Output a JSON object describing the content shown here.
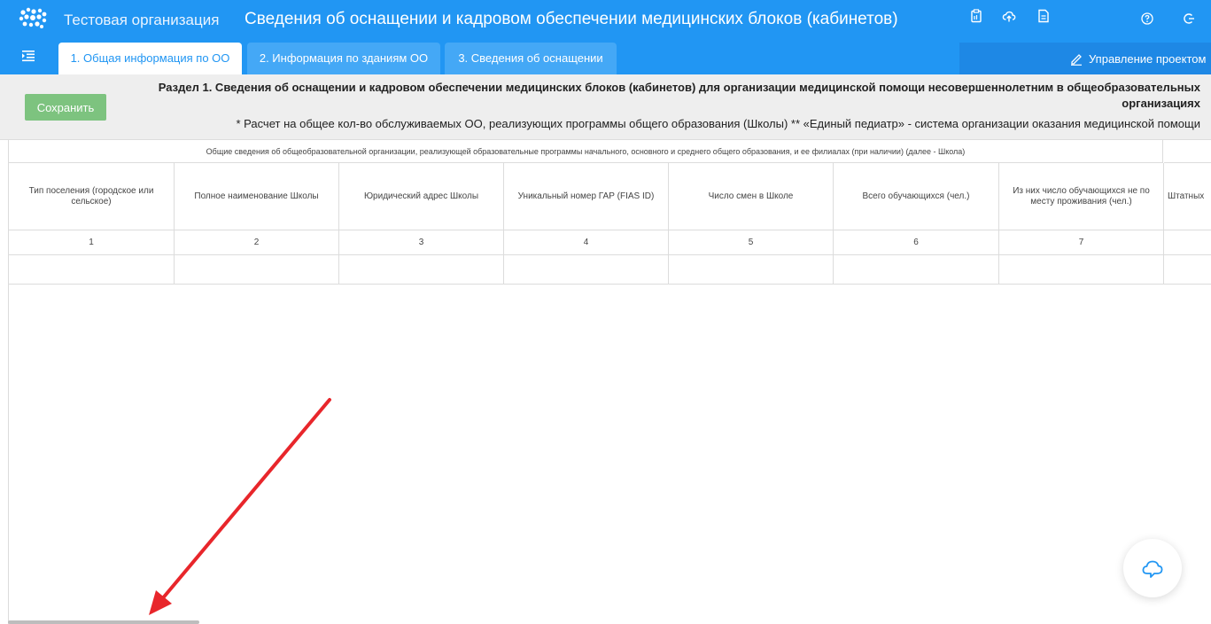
{
  "header": {
    "organization": "Тестовая организация",
    "app_title": "Сведения об оснащении и кадровом обеспечении медицинских блоков (кабинетов)",
    "brand_color": "#2196f3"
  },
  "tabs": [
    {
      "label": "1. Общая информация по ОО",
      "active": true
    },
    {
      "label": "2. Информация по зданиям ОО",
      "active": false
    },
    {
      "label": "3. Сведения об оснащении",
      "active": false
    }
  ],
  "toolbar": {
    "icons": [
      "clipboard-icon",
      "cloud-upload-icon",
      "document-icon",
      "pencil-icon"
    ],
    "manage_label": "Управление проектом"
  },
  "section": {
    "save_label": "Сохранить",
    "title": "Раздел 1. Сведения об оснащении и кадровом обеспечении медицинских блоков (кабинетов) для организации медицинской помощи несовершеннолетним в общеобразовательных организациях",
    "note": "* Расчет на общее кол-во обслуживаемых ОО, реализующих программы общего образования (Школы) ** «Единый педиатр» - система организации оказания медицинской помощи"
  },
  "table": {
    "group_header": "Общие сведения об общеобразовательной организации, реализующей образовательные программы начального, основного и среднего общего образования, и ее филиалах (при наличии) (далее - Школа)",
    "columns": [
      {
        "label": "Тип поселения (городское или сельское)",
        "num": "1"
      },
      {
        "label": "Полное наименование Школы",
        "num": "2"
      },
      {
        "label": "Юридический адрес Школы",
        "num": "3"
      },
      {
        "label": "Уникальный номер ГАР (FIAS ID)",
        "num": "4"
      },
      {
        "label": "Число смен в Школе",
        "num": "5"
      },
      {
        "label": "Всего обучающихся (чел.)",
        "num": "6"
      },
      {
        "label": "Из них число обучающихся не по месту проживания (чел.)",
        "num": "7"
      },
      {
        "label": "Штатных",
        "num": ""
      }
    ]
  },
  "annotation": {
    "color": "#e8262b"
  }
}
